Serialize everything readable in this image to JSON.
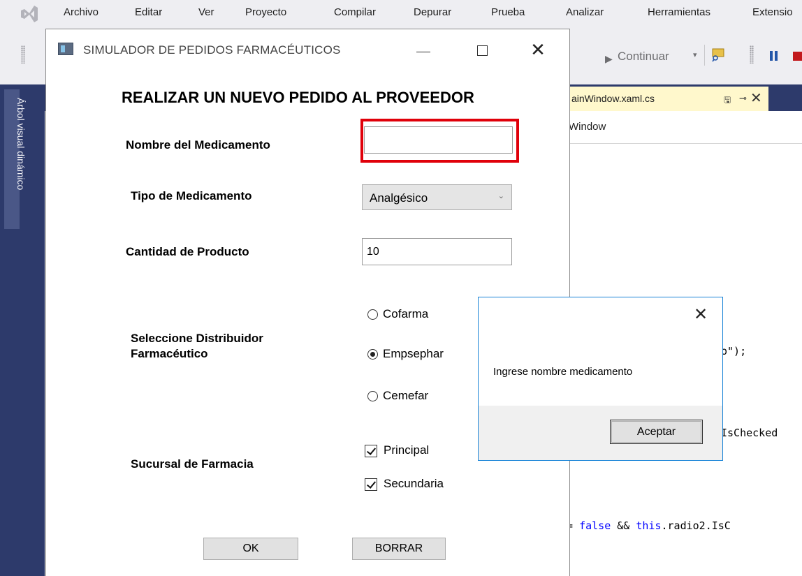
{
  "ide": {
    "menu": [
      "Archivo",
      "Editar",
      "Ver",
      "Proyecto",
      "Compilar",
      "Depurar",
      "Prueba",
      "Analizar",
      "Herramientas",
      "Extensio"
    ],
    "toolbar": {
      "continue_label": "Continuar",
      "continue_icon": "play-icon",
      "dropdown_glyph": "▾"
    },
    "side_panel_label": "Árbol visual dinámico",
    "editor_tab": {
      "title": "ainWindow.xaml.cs",
      "pin_glyph": "🖫",
      "keep_glyph": "⊸",
      "close_glyph": "✕"
    },
    "nav_bar_text": "Window",
    "code": {
      "line1": "o\");",
      "line2": "IsChecked",
      "line3_plain1": "== ",
      "line3_kw1": "false",
      "line3_plain2": " && ",
      "line3_kw2": "this",
      "line3_plain3": ".radio2.IsC"
    },
    "colors": {
      "accent": "#2d3a6b",
      "tab_active": "#fff8cc",
      "stop": "#c2191d",
      "pause": "#2456a8"
    }
  },
  "window": {
    "title": "SIMULADOR DE PEDIDOS FARMACÉUTICOS",
    "minimize_glyph": "",
    "close_glyph": "✕"
  },
  "form": {
    "heading": "REALIZAR UN NUEVO PEDIDO AL PROVEEDOR",
    "med_name": {
      "label": "Nombre del Medicamento",
      "value": ""
    },
    "med_type": {
      "label": "Tipo de Medicamento",
      "value": "Analgésico",
      "chevron": "⌄"
    },
    "quantity": {
      "label": "Cantidad de Producto",
      "value": "10"
    },
    "distributor": {
      "label_line1": "Seleccione Distribuidor",
      "label_line2": "Farmacéutico",
      "options": [
        "Cofarma",
        "Empsephar",
        "Cemefar"
      ],
      "selected": "Empsephar"
    },
    "branch": {
      "label": "Sucursal de Farmacia",
      "options": [
        {
          "label": "Principal",
          "checked": true
        },
        {
          "label": "Secundaria",
          "checked": true
        }
      ]
    },
    "buttons": {
      "ok": "OK",
      "clear": "BORRAR"
    },
    "colors": {
      "validation_border": "#e0000a"
    }
  },
  "message_box": {
    "text": "Ingrese nombre medicamento",
    "close_glyph": "✕",
    "accept_label": "Aceptar",
    "border_color": "#1883d7"
  }
}
